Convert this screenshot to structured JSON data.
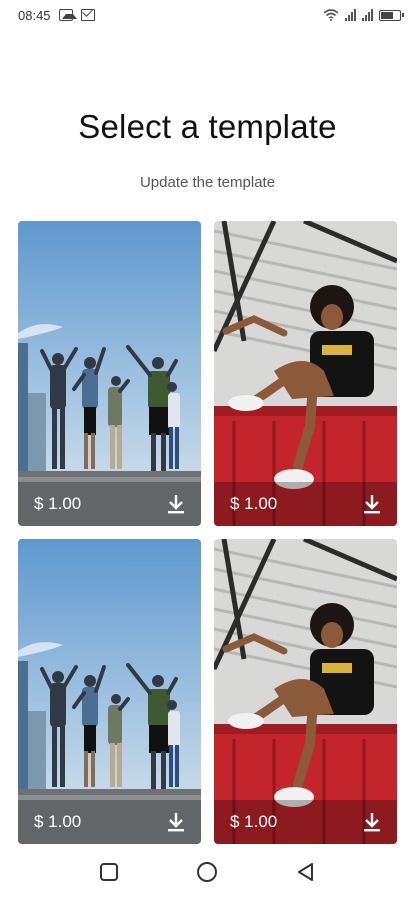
{
  "status_bar": {
    "time": "08:45",
    "icons": [
      "image-icon",
      "mail-icon",
      "wifi-icon",
      "signal-icon",
      "signal-icon",
      "battery-icon"
    ]
  },
  "header": {
    "title": "Select a template",
    "subtitle": "Update the template"
  },
  "templates": [
    {
      "price": "$ 1.00",
      "art": "group-on-rooftop-photo",
      "download_icon": "download-icon"
    },
    {
      "price": "$ 1.00",
      "art": "woman-on-red-container-photo",
      "download_icon": "download-icon"
    },
    {
      "price": "$ 1.00",
      "art": "group-on-rooftop-photo",
      "download_icon": "download-icon"
    },
    {
      "price": "$ 1.00",
      "art": "woman-on-red-container-photo",
      "download_icon": "download-icon"
    }
  ],
  "nav_bar": {
    "buttons": [
      "recents-square-icon",
      "home-circle-icon",
      "back-triangle-icon"
    ]
  },
  "colors": {
    "background": "#ffffff",
    "price_text": "#ffffff",
    "sky": "#7fb2df",
    "container_red": "#c4252c"
  }
}
